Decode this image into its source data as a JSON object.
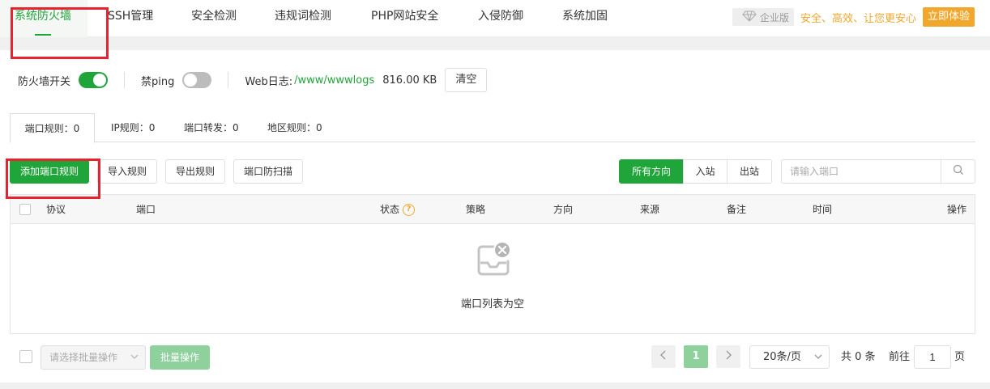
{
  "nav": {
    "tabs": [
      {
        "label": "系统防火墙",
        "active": true
      },
      {
        "label": "SSH管理"
      },
      {
        "label": "安全检测"
      },
      {
        "label": "违规词检测"
      },
      {
        "label": "PHP网站安全"
      },
      {
        "label": "入侵防御"
      },
      {
        "label": "系统加固"
      }
    ],
    "vip": {
      "badge_label": "企业版",
      "slogan": "安全、高效、让您更安心",
      "cta_label": "立即体验",
      "accent_color": "#f0a72c",
      "icon": "diamond-icon"
    }
  },
  "settings": {
    "firewall_label": "防火墙开关",
    "firewall_on": true,
    "ping_label": "禁ping",
    "ping_on": false,
    "log_label": "Web日志:",
    "log_path": "/www/wwwlogs",
    "log_size": "816.00 KB",
    "clear_label": "清空"
  },
  "subtabs": [
    {
      "label": "端口规则：0",
      "active": true
    },
    {
      "label": "IP规则：0"
    },
    {
      "label": "端口转发：0"
    },
    {
      "label": "地区规则：0"
    }
  ],
  "toolbar": {
    "add_label": "添加端口规则",
    "import_label": "导入规则",
    "export_label": "导出规则",
    "scan_label": "端口防扫描",
    "directions": [
      "所有方向",
      "入站",
      "出站"
    ],
    "active_direction": "所有方向",
    "search_placeholder": "请输入端口"
  },
  "table": {
    "columns": [
      "协议",
      "端口",
      "状态",
      "策略",
      "方向",
      "来源",
      "备注",
      "时间",
      "操作"
    ],
    "rows": [],
    "empty_text": "端口列表为空"
  },
  "footer": {
    "batch_placeholder": "请选择批量操作",
    "batch_button": "批量操作",
    "current_page": "1",
    "page_size": "20条/页",
    "total_text": "共 0 条",
    "goto_prefix": "前往",
    "goto_value": "1",
    "goto_suffix": "页"
  },
  "colors": {
    "primary": "#20a53a",
    "highlight_box": "#e8232f"
  }
}
